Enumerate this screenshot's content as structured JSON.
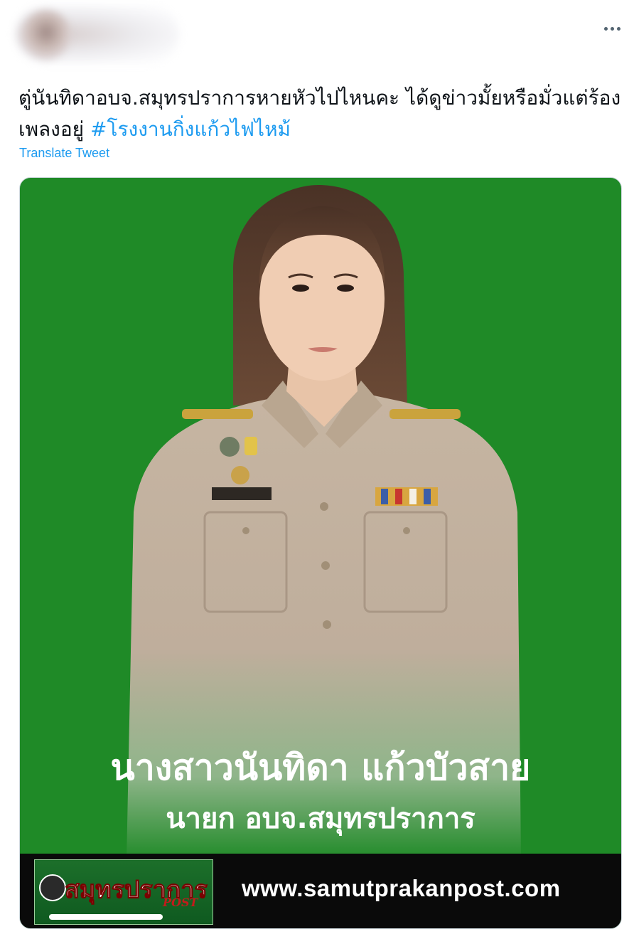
{
  "header": {
    "more_icon": "more-horizontal-icon"
  },
  "tweet": {
    "text_main": "ตู่นันทิดาอบจ.สมุทรปราการหายหัวไปไหนคะ ได้ดูข่าวมั้ยหรือมั่วแต่ร้องเพลงอยู่ ",
    "hashtag": "#โรงงานกิ่งแก้วไฟไหม้",
    "translate_label": "Translate Tweet"
  },
  "media": {
    "caption_name": "นางสาวนันทิดา แก้วบัวสาย",
    "caption_title": "นายก อบจ.สมุทรปราการ",
    "website": "www.samutprakanpost.com",
    "logo_text": "สมุทรปราการ",
    "logo_post": "POST",
    "background_color": "#1f8a27"
  }
}
